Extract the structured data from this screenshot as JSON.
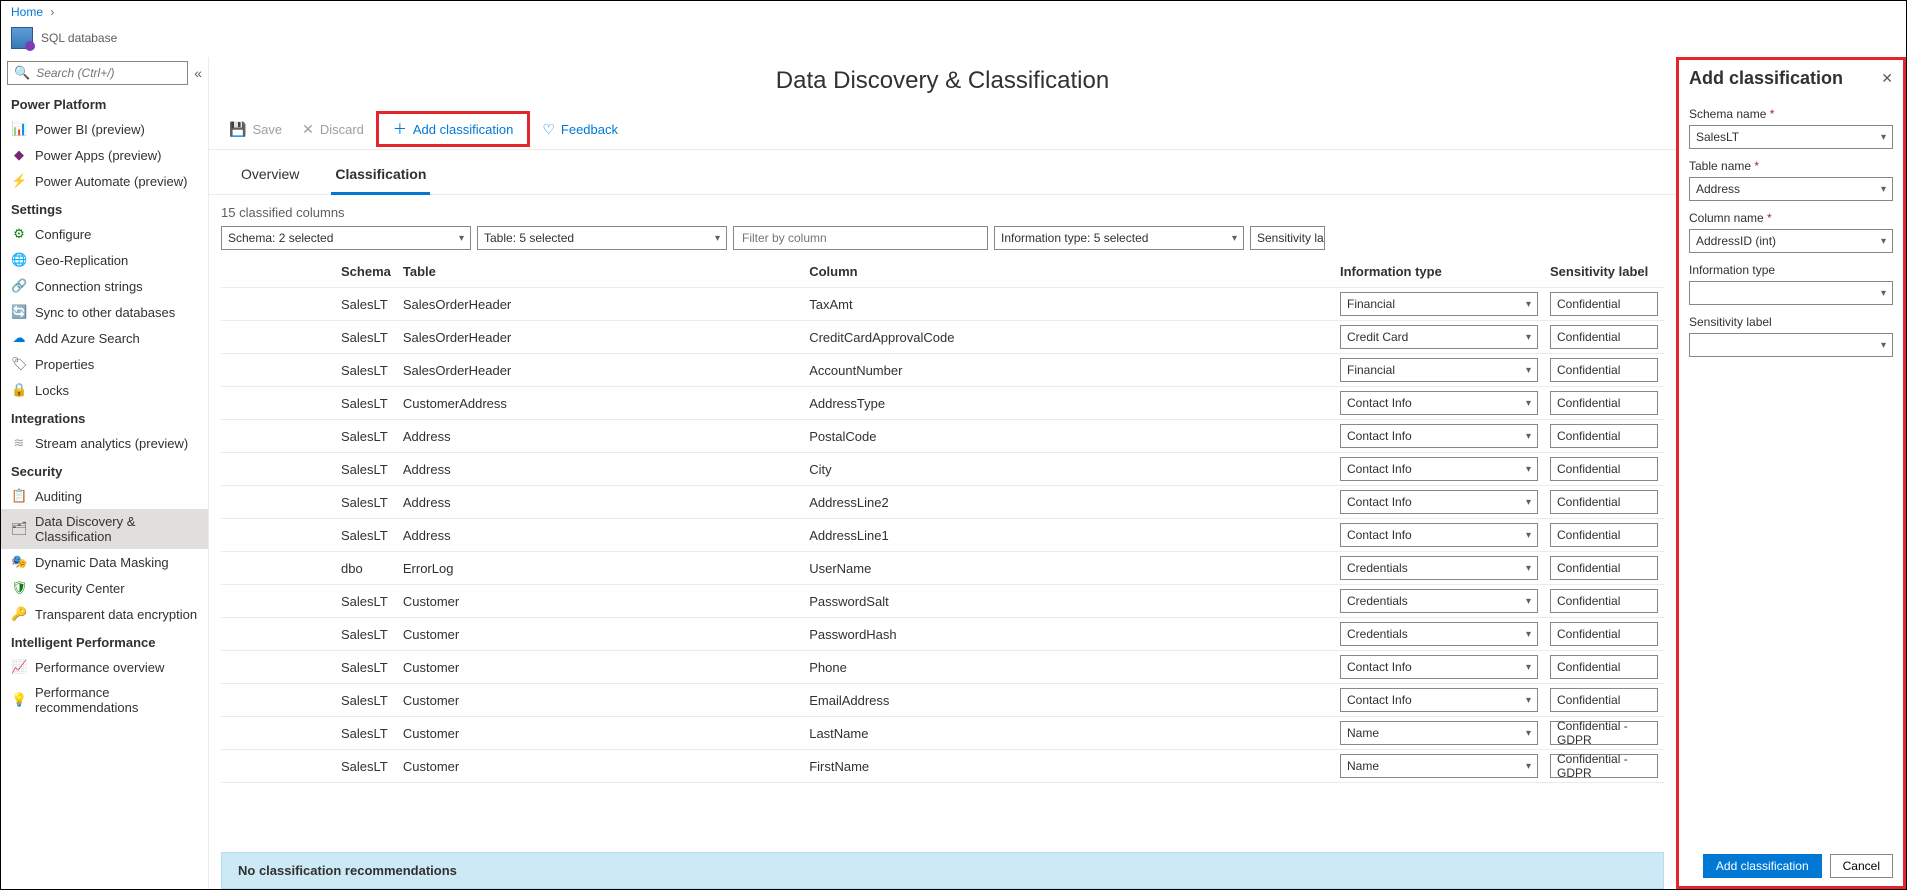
{
  "breadcrumb": {
    "home": "Home"
  },
  "db": {
    "label": "SQL database"
  },
  "search": {
    "placeholder": "Search (Ctrl+/)"
  },
  "sidebar": {
    "sections": [
      {
        "title": "Power Platform",
        "items": [
          {
            "label": "Power BI (preview)",
            "icon": "📊",
            "color": "#f2c811"
          },
          {
            "label": "Power Apps (preview)",
            "icon": "◆",
            "color": "#742774"
          },
          {
            "label": "Power Automate (preview)",
            "icon": "⚡",
            "color": "#0066ff"
          }
        ]
      },
      {
        "title": "Settings",
        "items": [
          {
            "label": "Configure",
            "icon": "⚙",
            "color": "#107c10"
          },
          {
            "label": "Geo-Replication",
            "icon": "🌐",
            "color": "#0078d4"
          },
          {
            "label": "Connection strings",
            "icon": "🔗",
            "color": "#323130"
          },
          {
            "label": "Sync to other databases",
            "icon": "🔄",
            "color": "#0078d4"
          },
          {
            "label": "Add Azure Search",
            "icon": "☁",
            "color": "#0078d4"
          },
          {
            "label": "Properties",
            "icon": "🏷",
            "color": "#605e5c"
          },
          {
            "label": "Locks",
            "icon": "🔒",
            "color": "#0078d4"
          }
        ]
      },
      {
        "title": "Integrations",
        "items": [
          {
            "label": "Stream analytics (preview)",
            "icon": "≋",
            "color": "#a19f9d"
          }
        ]
      },
      {
        "title": "Security",
        "items": [
          {
            "label": "Auditing",
            "icon": "📋",
            "color": "#0078d4"
          },
          {
            "label": "Data Discovery & Classification",
            "icon": "🗂",
            "color": "#605e5c",
            "selected": true
          },
          {
            "label": "Dynamic Data Masking",
            "icon": "🎭",
            "color": "#0078d4"
          },
          {
            "label": "Security Center",
            "icon": "🛡",
            "color": "#107c10"
          },
          {
            "label": "Transparent data encryption",
            "icon": "🔑",
            "color": "#605e5c"
          }
        ]
      },
      {
        "title": "Intelligent Performance",
        "items": [
          {
            "label": "Performance overview",
            "icon": "📈",
            "color": "#0078d4"
          },
          {
            "label": "Performance recommendations",
            "icon": "💡",
            "color": "#605e5c"
          }
        ]
      }
    ]
  },
  "page": {
    "title": "Data Discovery & Classification"
  },
  "cmdbar": {
    "save": "Save",
    "discard": "Discard",
    "add": "Add classification",
    "feedback": "Feedback"
  },
  "tabs": {
    "overview": "Overview",
    "classification": "Classification"
  },
  "summary": "15 classified columns",
  "filters": {
    "schema": "Schema: 2 selected",
    "table": "Table: 5 selected",
    "column_placeholder": "Filter by column",
    "info": "Information type: 5 selected",
    "sens": "Sensitivity la"
  },
  "headers": {
    "schema": "Schema",
    "table": "Table",
    "column": "Column",
    "info": "Information type",
    "sens": "Sensitivity label"
  },
  "rows": [
    {
      "schema": "SalesLT",
      "table": "SalesOrderHeader",
      "column": "TaxAmt",
      "info": "Financial",
      "sens": "Confidential"
    },
    {
      "schema": "SalesLT",
      "table": "SalesOrderHeader",
      "column": "CreditCardApprovalCode",
      "info": "Credit Card",
      "sens": "Confidential"
    },
    {
      "schema": "SalesLT",
      "table": "SalesOrderHeader",
      "column": "AccountNumber",
      "info": "Financial",
      "sens": "Confidential"
    },
    {
      "schema": "SalesLT",
      "table": "CustomerAddress",
      "column": "AddressType",
      "info": "Contact Info",
      "sens": "Confidential"
    },
    {
      "schema": "SalesLT",
      "table": "Address",
      "column": "PostalCode",
      "info": "Contact Info",
      "sens": "Confidential"
    },
    {
      "schema": "SalesLT",
      "table": "Address",
      "column": "City",
      "info": "Contact Info",
      "sens": "Confidential"
    },
    {
      "schema": "SalesLT",
      "table": "Address",
      "column": "AddressLine2",
      "info": "Contact Info",
      "sens": "Confidential"
    },
    {
      "schema": "SalesLT",
      "table": "Address",
      "column": "AddressLine1",
      "info": "Contact Info",
      "sens": "Confidential"
    },
    {
      "schema": "dbo",
      "table": "ErrorLog",
      "column": "UserName",
      "info": "Credentials",
      "sens": "Confidential"
    },
    {
      "schema": "SalesLT",
      "table": "Customer",
      "column": "PasswordSalt",
      "info": "Credentials",
      "sens": "Confidential"
    },
    {
      "schema": "SalesLT",
      "table": "Customer",
      "column": "PasswordHash",
      "info": "Credentials",
      "sens": "Confidential"
    },
    {
      "schema": "SalesLT",
      "table": "Customer",
      "column": "Phone",
      "info": "Contact Info",
      "sens": "Confidential"
    },
    {
      "schema": "SalesLT",
      "table": "Customer",
      "column": "EmailAddress",
      "info": "Contact Info",
      "sens": "Confidential"
    },
    {
      "schema": "SalesLT",
      "table": "Customer",
      "column": "LastName",
      "info": "Name",
      "sens": "Confidential - GDPR"
    },
    {
      "schema": "SalesLT",
      "table": "Customer",
      "column": "FirstName",
      "info": "Name",
      "sens": "Confidential - GDPR"
    }
  ],
  "no_rec": "No classification recommendations",
  "panel": {
    "title": "Add classification",
    "schema_label": "Schema name",
    "schema_value": "SalesLT",
    "table_label": "Table name",
    "table_value": "Address",
    "column_label": "Column name",
    "column_value": "AddressID (int)",
    "info_label": "Information type",
    "info_value": "",
    "sens_label": "Sensitivity label",
    "sens_value": "",
    "add_btn": "Add classification",
    "cancel_btn": "Cancel"
  }
}
